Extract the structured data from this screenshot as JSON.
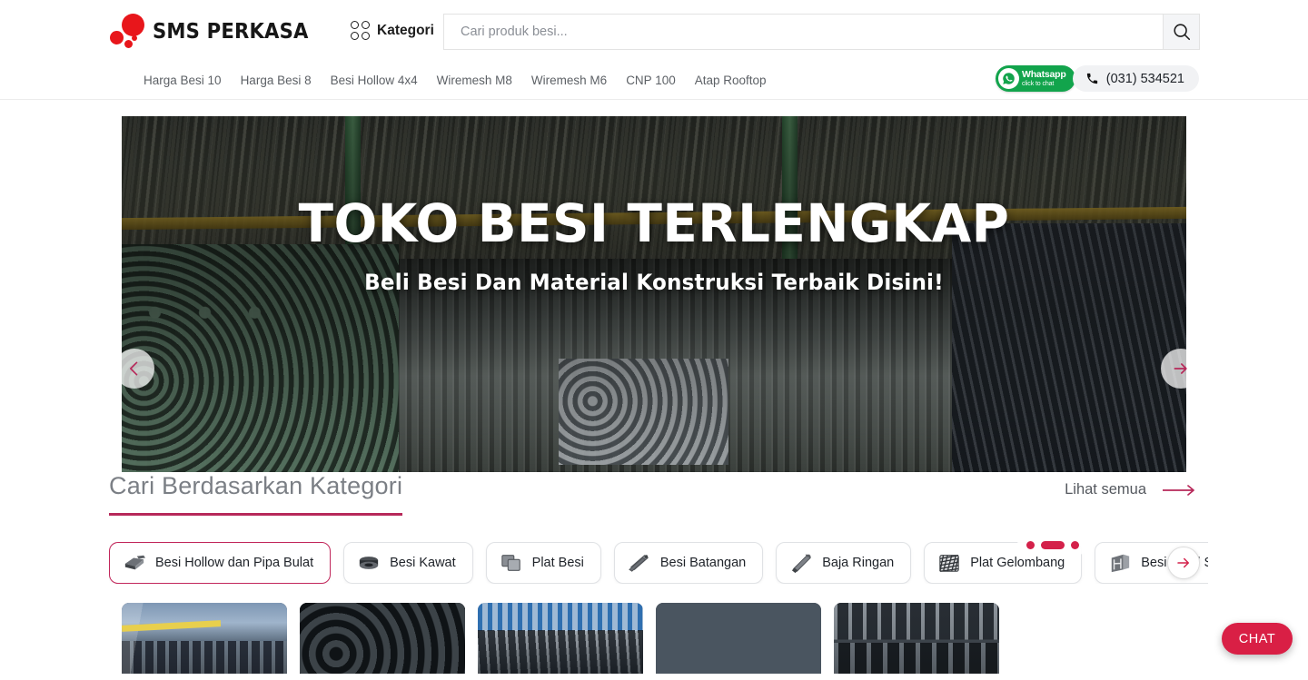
{
  "header": {
    "brand_name": "SMS PERKASA",
    "kategori_label": "Kategori",
    "search_placeholder": "Cari produk besi...",
    "search_value": ""
  },
  "subnav": {
    "links": [
      {
        "label": "Harga Besi 10"
      },
      {
        "label": "Harga Besi 8"
      },
      {
        "label": "Besi Hollow 4x4"
      },
      {
        "label": "Wiremesh M8"
      },
      {
        "label": "Wiremesh M6"
      },
      {
        "label": "CNP 100"
      },
      {
        "label": "Atap Rooftop"
      }
    ],
    "whatsapp_title": "Whatsapp",
    "whatsapp_subtitle": "click to chat",
    "phone": "(031) 534521"
  },
  "hero": {
    "title": "TOKO BESI TERLENGKAP",
    "subtitle": "Beli Besi Dan Material Konstruksi Terbaik Disini!",
    "slide_count": 3,
    "active_slide": 2
  },
  "categories": {
    "section_title": "Cari Berdasarkan Kategori",
    "see_all_label": "Lihat semua",
    "chips": [
      {
        "label": "Besi Hollow dan Pipa Bulat",
        "icon": "hollow-pipe-icon",
        "active": true
      },
      {
        "label": "Besi Kawat",
        "icon": "wire-coil-icon",
        "active": false
      },
      {
        "label": "Plat Besi",
        "icon": "plate-stack-icon",
        "active": false
      },
      {
        "label": "Besi Batangan",
        "icon": "bar-bundle-icon",
        "active": false
      },
      {
        "label": "Baja Ringan",
        "icon": "light-steel-icon",
        "active": false
      },
      {
        "label": "Plat Gelombang",
        "icon": "corrugated-plate-icon",
        "active": false
      },
      {
        "label": "Besi Profil Struktural",
        "icon": "h-beam-icon",
        "active": false
      },
      {
        "label": "",
        "icon": "partial-icon",
        "active": false
      }
    ]
  },
  "products": {
    "cards": [
      {
        "name": "hollow-square-warehouse"
      },
      {
        "name": "black-round-pipes"
      },
      {
        "name": "blue-rack-pipes"
      },
      {
        "name": "galvanized-pipe-bundle"
      },
      {
        "name": "square-hollow-stack"
      }
    ]
  },
  "chat": {
    "label": "CHAT"
  },
  "colors": {
    "brand_red": "#e8161b",
    "accent_crimson": "#c2275b",
    "chat_red": "#d91f45",
    "whatsapp_green": "#12a44c"
  }
}
